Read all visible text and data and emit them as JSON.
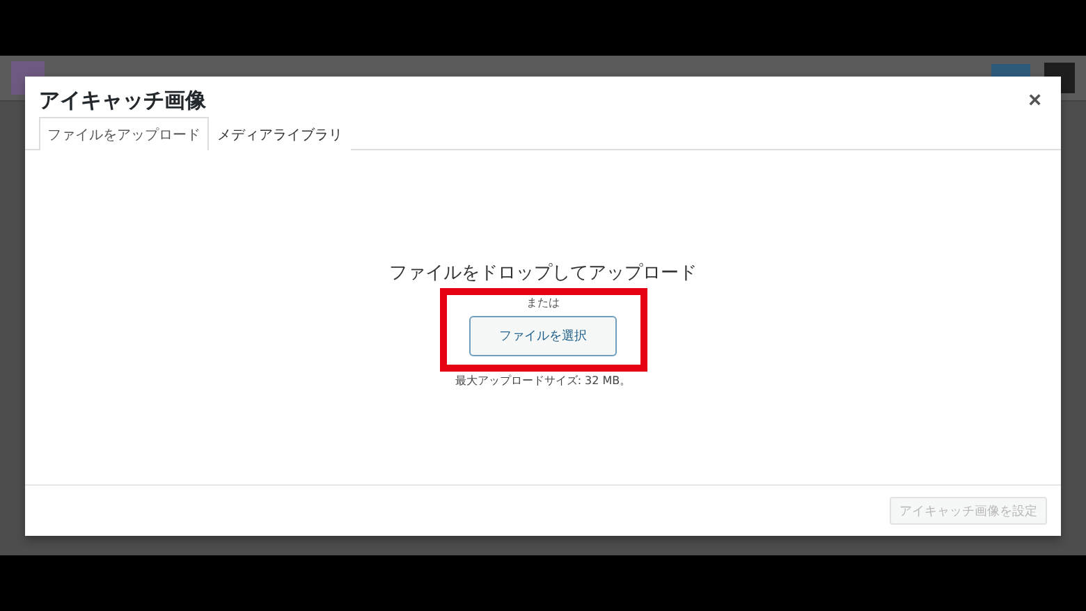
{
  "modal": {
    "title": "アイキャッチ画像",
    "close": "×",
    "tabs": [
      {
        "label": "ファイルをアップロード",
        "selected": true
      },
      {
        "label": "メディアライブラリ",
        "selected": false
      }
    ],
    "upload": {
      "heading": "ファイルをドロップしてアップロード",
      "or": "または",
      "button": "ファイルを選択",
      "note": "最大アップロードサイズ: 32 MB。",
      "highlighted": true
    },
    "footer_button": {
      "label": "アイキャッチ画像を設定",
      "disabled": true
    }
  }
}
